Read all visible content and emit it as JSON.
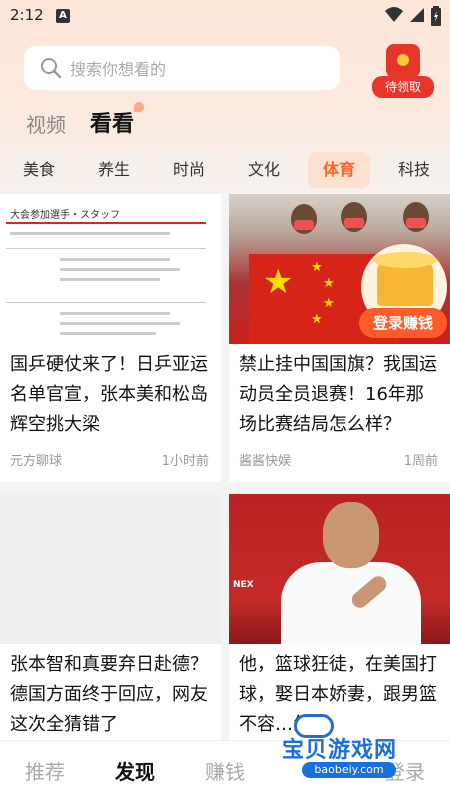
{
  "status_bar": {
    "time": "2:12",
    "notification_icon": "A"
  },
  "search": {
    "placeholder": "搜索你想看的"
  },
  "reward": {
    "label": "待领取"
  },
  "top_tabs": [
    {
      "label": "视频",
      "active": false
    },
    {
      "label": "看看",
      "active": true
    }
  ],
  "categories": [
    {
      "label": "美食",
      "active": false
    },
    {
      "label": "养生",
      "active": false
    },
    {
      "label": "时尚",
      "active": false
    },
    {
      "label": "文化",
      "active": false
    },
    {
      "label": "体育",
      "active": true
    },
    {
      "label": "科技",
      "active": false
    }
  ],
  "feed": [
    {
      "title": "国乒硬仗来了！日乒亚运名单官宣，张本美和松岛辉空挑大梁",
      "source": "元方聊球",
      "time": "1小时前"
    },
    {
      "title": "禁止挂中国国旗？我国运动员全员退赛！16年那场比赛结局怎么样？",
      "source": "酱酱快娱",
      "time": "1周前",
      "promo_label": "登录赚钱"
    },
    {
      "title": "张本智和真要弃日赴德？德国方面终于回应，网友这次全猜错了",
      "source": "",
      "time": ""
    },
    {
      "title": "他，篮球狂徒，在美国打球，娶日本娇妻，跟男篮不容…怎样",
      "source": "",
      "time": ""
    }
  ],
  "doc_thumb": {
    "header": "大会参加選手・スタッフ"
  },
  "bottom_nav": [
    {
      "label": "推荐",
      "active": false
    },
    {
      "label": "发现",
      "active": true
    },
    {
      "label": "赚钱",
      "active": false
    },
    {
      "label": "",
      "active": false
    },
    {
      "label": "登录",
      "active": false
    }
  ],
  "watermark": {
    "text": "宝贝游戏网",
    "url": "baobeiy.com"
  },
  "colors": {
    "accent": "#f06a2a",
    "promo": "#ff5a2a",
    "watermark": "#1a6fd8"
  }
}
